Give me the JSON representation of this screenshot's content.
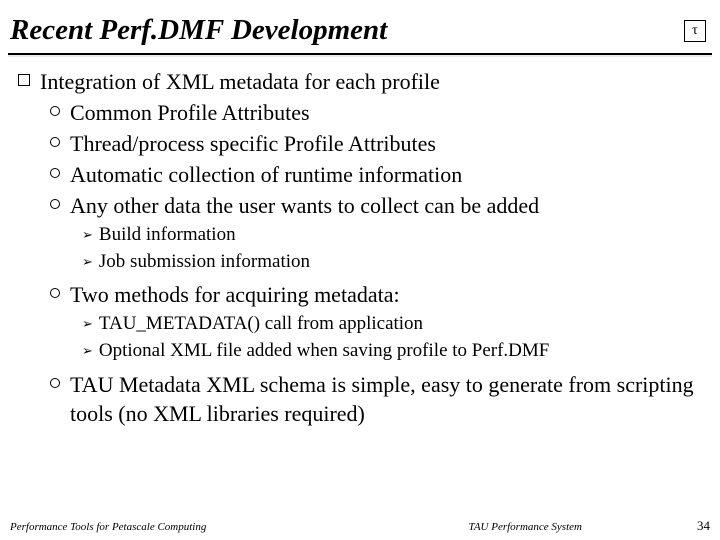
{
  "title": "Recent Perf.DMF Development",
  "logo_glyph": "τ",
  "main": "Integration of XML metadata for each profile",
  "items": {
    "a": "Common Profile Attributes",
    "b": "Thread/process specific Profile Attributes",
    "c": "Automatic collection of runtime information",
    "d": "Any other data the user wants to collect can be added",
    "d1": "Build information",
    "d2": "Job submission information",
    "e": "Two methods for acquiring metadata:",
    "e1": "TAU_METADATA() call from application",
    "e2": "Optional XML file added when saving profile to Perf.DMF",
    "f": "TAU Metadata XML schema is simple, easy to generate from scripting tools (no XML libraries required)"
  },
  "footer": {
    "left": "Performance Tools for Petascale Computing",
    "center": "TAU Performance System",
    "page": "34"
  }
}
